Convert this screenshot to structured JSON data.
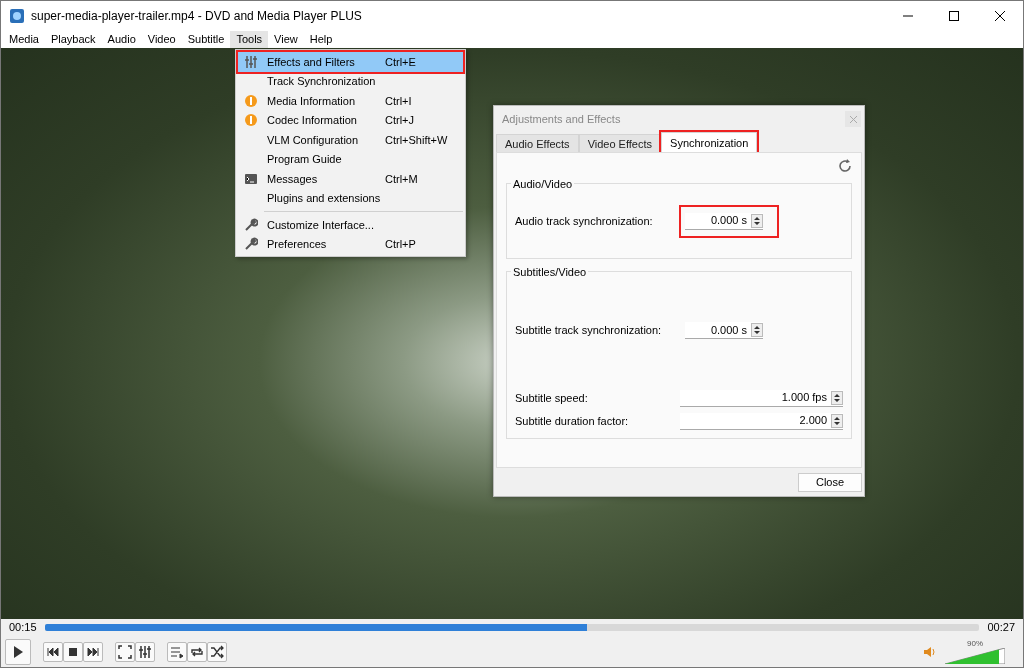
{
  "window": {
    "title": "super-media-player-trailer.mp4 - DVD and Media Player PLUS"
  },
  "menubar": [
    {
      "label": "Media",
      "selected": false
    },
    {
      "label": "Playback",
      "selected": false
    },
    {
      "label": "Audio",
      "selected": false
    },
    {
      "label": "Video",
      "selected": false
    },
    {
      "label": "Subtitle",
      "selected": false
    },
    {
      "label": "Tools",
      "selected": true
    },
    {
      "label": "View",
      "selected": false
    },
    {
      "label": "Help",
      "selected": false
    }
  ],
  "tools_menu": [
    {
      "kind": "sliders",
      "label": "Effects and Filters",
      "shortcut": "Ctrl+E",
      "selected": true,
      "annotated": true
    },
    {
      "kind": "plain",
      "label": "Track Synchronization",
      "selected": false,
      "annotated": false
    },
    {
      "kind": "info",
      "label": "Media Information",
      "shortcut": "Ctrl+I",
      "selected": false,
      "annotated": false
    },
    {
      "kind": "info",
      "label": "Codec Information",
      "shortcut": "Ctrl+J",
      "selected": false,
      "annotated": false
    },
    {
      "kind": "plain",
      "label": "VLM Configuration",
      "shortcut": "Ctrl+Shift+W",
      "selected": false,
      "annotated": false
    },
    {
      "kind": "plain",
      "label": "Program Guide",
      "selected": false,
      "annotated": false
    },
    {
      "kind": "terminal",
      "label": "Messages",
      "shortcut": "Ctrl+M",
      "selected": false,
      "annotated": false
    },
    {
      "kind": "plain",
      "label": "Plugins and extensions",
      "selected": false,
      "annotated": false
    },
    {
      "kind": "separator"
    },
    {
      "kind": "wrench",
      "label": "Customize Interface...",
      "selected": false,
      "annotated": false
    },
    {
      "kind": "wrench",
      "label": "Preferences",
      "shortcut": "Ctrl+P",
      "selected": false,
      "annotated": false
    }
  ],
  "dialog": {
    "title": "Adjustments and Effects",
    "tabs": [
      {
        "label": "Audio Effects",
        "selected": false,
        "annotated": false
      },
      {
        "label": "Video Effects",
        "selected": false,
        "annotated": false
      },
      {
        "label": "Synchronization",
        "selected": true,
        "annotated": true
      }
    ],
    "groups": [
      {
        "title": "Audio/Video",
        "rows": [
          {
            "label": "Audio track synchronization:",
            "value": "0.000 s",
            "kind": "short",
            "annotated": true
          }
        ]
      },
      {
        "title": "Subtitles/Video",
        "rows": [
          {
            "label": "Subtitle track synchronization:",
            "value": "0.000 s",
            "kind": "short",
            "annotated": false
          },
          {
            "label": "Subtitle speed:",
            "value": "1.000 fps",
            "kind": "wide",
            "annotated": false
          },
          {
            "label": "Subtitle duration factor:",
            "value": "2.000",
            "kind": "wide",
            "annotated": false
          }
        ]
      }
    ],
    "close_button": "Close"
  },
  "player": {
    "elapsed": "00:15",
    "total": "00:27",
    "seek": {
      "level": 0.58
    },
    "volume": {
      "level": 0.9,
      "reading": "90%"
    }
  }
}
